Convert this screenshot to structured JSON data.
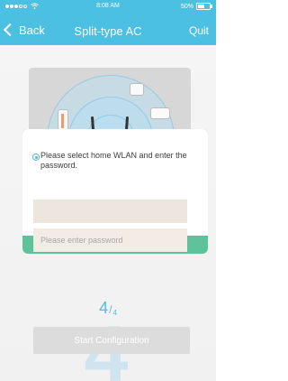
{
  "status_bar": {
    "carrier_icon": "signal-dots-icon",
    "wifi_icon": "wifi-icon",
    "time": "8:08 AM",
    "battery_text": "50%",
    "battery_icon": "battery-icon"
  },
  "nav": {
    "back_label": "Back",
    "title": "Split-type AC",
    "quit_label": "Quit"
  },
  "form": {
    "instruction": "Please select home WLAN and enter the password.",
    "ssid_value": "",
    "password_placeholder": "Please enter password"
  },
  "step": {
    "current": "4",
    "total": "4"
  },
  "watermark_digit": "4",
  "start_button_label": "Start Configuration",
  "colors": {
    "header": "#4cc0e2",
    "card_footer": "#5ec39b",
    "button": "#dcdcdc",
    "accent": "#4fb6e6"
  },
  "illustration": {
    "icons": [
      "router-icon",
      "fan-device-icon",
      "air-purifier-icon",
      "ac-unit-icon",
      "signal-rings-icon"
    ]
  }
}
